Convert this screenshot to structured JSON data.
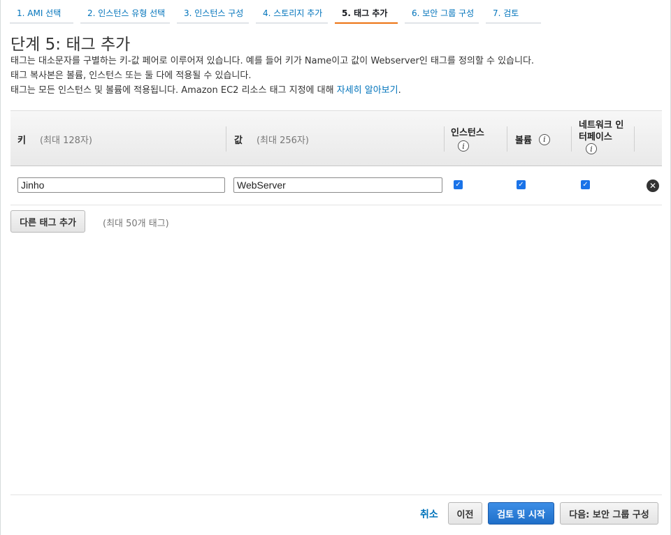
{
  "steps": [
    {
      "label": "1. AMI 선택"
    },
    {
      "label": "2. 인스턴스 유형 선택"
    },
    {
      "label": "3. 인스턴스 구성"
    },
    {
      "label": "4. 스토리지 추가"
    },
    {
      "label": "5. 태그 추가"
    },
    {
      "label": "6. 보안 그룹 구성"
    },
    {
      "label": "7. 검토"
    }
  ],
  "page": {
    "title": "단계 5: 태그 추가",
    "desc1": "태그는 대소문자를 구별하는 키-값 페어로 이루어져 있습니다. 예를 들어 키가 Name이고 값이 Webserver인 태그를 정의할 수 있습니다.",
    "desc2": "태그 복사본은 볼륨, 인스턴스 또는 둘 다에 적용될 수 있습니다.",
    "desc3": "태그는 모든 인스턴스 및 볼륨에 적용됩니다. Amazon EC2 리소스 태그 지정에 대해",
    "learn_more": "자세히 알아보기",
    "desc3_end": "."
  },
  "table": {
    "key_header": "키",
    "key_hint": "(최대 128자)",
    "value_header": "값",
    "value_hint": "(최대 256자)",
    "instances_header": "인스턴스",
    "volumes_header": "볼륨",
    "eni_header_line1": "네트워크 인",
    "eni_header_line2": "터페이스",
    "info_glyph": "i",
    "rows": [
      {
        "key": "Jinho",
        "value": "WebServer",
        "instances": true,
        "volumes": true,
        "network_interfaces": true
      }
    ]
  },
  "add_tag": {
    "button": "다른 태그 추가",
    "hint": "(최대 50개 태그)"
  },
  "footer": {
    "cancel": "취소",
    "previous": "이전",
    "review_launch": "검토 및 시작",
    "next": "다음: 보안 그룹 구성"
  },
  "colors": {
    "link": "#0073bb",
    "active_step": "#ec7211",
    "primary_button": "#1f6fc9",
    "checkbox": "#1a73e8"
  }
}
